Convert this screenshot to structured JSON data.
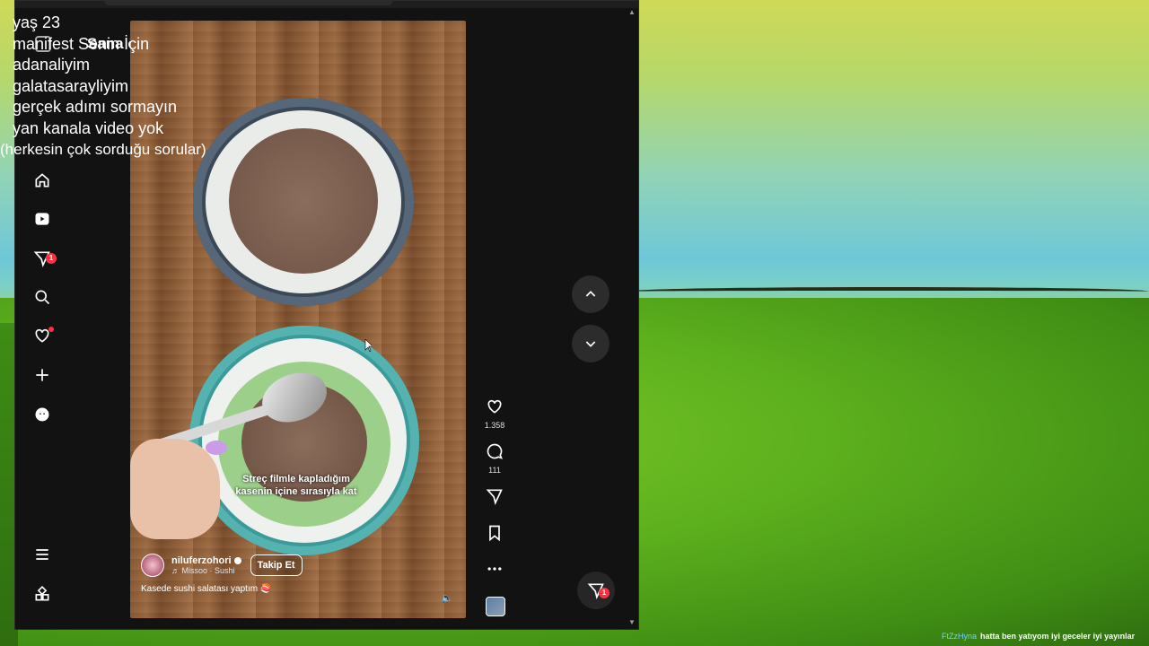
{
  "overlay_lines": [
    "yaş 23",
    "manifest Senin İçin",
    "adanaliyim",
    "galatasarayliyim",
    "gerçek adımı sormayın",
    "yan kanala video yok",
    "(herkesin çok sorduğu sorular)"
  ],
  "feed": {
    "title": "Sana özel"
  },
  "sidebar": {
    "items": [
      {
        "name": "home"
      },
      {
        "name": "reels"
      },
      {
        "name": "messages",
        "badge": "1"
      },
      {
        "name": "search"
      },
      {
        "name": "notifications"
      },
      {
        "name": "create"
      },
      {
        "name": "profile"
      }
    ]
  },
  "video": {
    "caption_line1": "Streç filmle kapladığım",
    "caption_line2": "kasenin içine sırasıyla kat",
    "author": "niluferzohori",
    "music": "♬ Missoo · Sushi",
    "follow_label": "Takip Et",
    "description": "Kasede sushi salatası yaptım 🍣"
  },
  "actions": {
    "likes": "1.358",
    "comments": "111"
  },
  "fab": {
    "badge": "1"
  },
  "chat": {
    "user": "FtZzHyna",
    "message": "hatta ben yatıyom iyi geceler iyi yayınlar"
  },
  "colors": {
    "app_bg": "#121212",
    "badge": "#ff3040",
    "text": "#ffffff"
  }
}
